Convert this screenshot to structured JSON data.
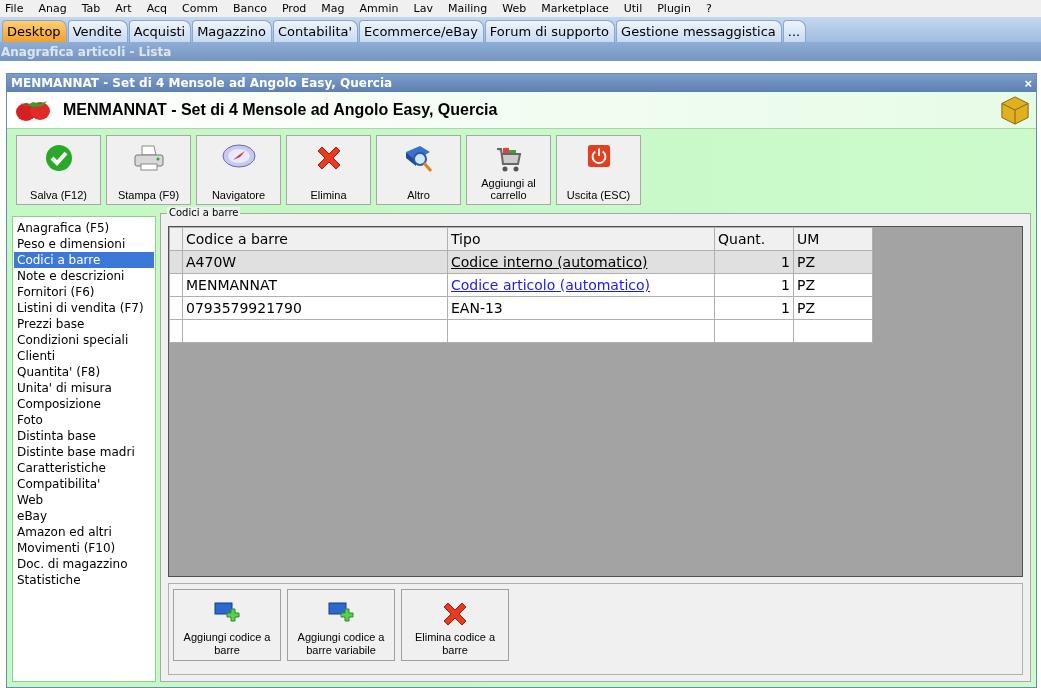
{
  "menu": [
    "File",
    "Anag",
    "Tab",
    "Art",
    "Acq",
    "Comm",
    "Banco",
    "Prod",
    "Mag",
    "Ammin",
    "Lav",
    "Mailing",
    "Web",
    "Marketplace",
    "Util",
    "Plugin",
    "?"
  ],
  "tabs": [
    {
      "label": "Desktop",
      "selected": true
    },
    {
      "label": "Vendite",
      "selected": false
    },
    {
      "label": "Acquisti",
      "selected": false
    },
    {
      "label": "Magazzino",
      "selected": false
    },
    {
      "label": "Contabilita'",
      "selected": false
    },
    {
      "label": "Ecommerce/eBay",
      "selected": false
    },
    {
      "label": "Forum di supporto",
      "selected": false
    },
    {
      "label": "Gestione messaggistica",
      "selected": false
    },
    {
      "label": "...",
      "selected": false
    }
  ],
  "breadcrumb": "Anagrafica articoli  - Lista",
  "window": {
    "title": "MENMANNAT - Set di 4 Mensole ad Angolo Easy, Quercia",
    "close": "×",
    "heading": "MENMANNAT - Set di 4 Mensole ad Angolo Easy, Quercia"
  },
  "toolbar": [
    {
      "label": "Salva (F12)",
      "kind": "check"
    },
    {
      "label": "Stampa (F9)",
      "kind": "printer"
    },
    {
      "label": "Navigatore",
      "kind": "compass"
    },
    {
      "label": "Elimina",
      "kind": "cross"
    },
    {
      "label": "Altro",
      "kind": "search"
    },
    {
      "label": "Aggiungi al carrello",
      "kind": "cart"
    },
    {
      "label": "Uscita (ESC)",
      "kind": "power"
    }
  ],
  "sidebar": {
    "items": [
      {
        "label": "Anagrafica (F5)",
        "selected": false
      },
      {
        "label": "Peso e dimensioni",
        "selected": false
      },
      {
        "label": "Codici a barre",
        "selected": true
      },
      {
        "label": "Note e descrizioni",
        "selected": false
      },
      {
        "label": "Fornitori (F6)",
        "selected": false
      },
      {
        "label": "Listini di vendita (F7)",
        "selected": false
      },
      {
        "label": "Prezzi base",
        "selected": false
      },
      {
        "label": "Condizioni speciali",
        "selected": false
      },
      {
        "label": "Clienti",
        "selected": false
      },
      {
        "label": "Quantita' (F8)",
        "selected": false
      },
      {
        "label": "Unita' di misura",
        "selected": false
      },
      {
        "label": "Composizione",
        "selected": false
      },
      {
        "label": "Foto",
        "selected": false
      },
      {
        "label": "Distinta base",
        "selected": false
      },
      {
        "label": "Distinte base madri",
        "selected": false
      },
      {
        "label": "Caratteristiche",
        "selected": false
      },
      {
        "label": "Compatibilita'",
        "selected": false
      },
      {
        "label": "Web",
        "selected": false
      },
      {
        "label": "eBay",
        "selected": false
      },
      {
        "label": "Amazon ed altri",
        "selected": false
      },
      {
        "label": "Movimenti (F10)",
        "selected": false
      },
      {
        "label": "Doc. di magazzino",
        "selected": false
      },
      {
        "label": "Statistiche",
        "selected": false
      }
    ]
  },
  "group": {
    "title": "Codici a barre",
    "table": {
      "columns": [
        "Codice a barre",
        "Tipo",
        "Quant.",
        "UM"
      ],
      "rows": [
        {
          "code": "A470W",
          "type": "Codice interno (automatico)",
          "link": true,
          "quantity": "1",
          "unit": "PZ",
          "selected": true
        },
        {
          "code": "MENMANNAT",
          "type": "Codice articolo (automatico)",
          "link": true,
          "quantity": "1",
          "unit": "PZ",
          "selected": false
        },
        {
          "code": "0793579921790",
          "type": "EAN-13",
          "link": false,
          "quantity": "1",
          "unit": "PZ",
          "selected": false
        }
      ]
    },
    "buttons": [
      {
        "label": "Aggiungi codice a barre",
        "kind": "add"
      },
      {
        "label": "Aggiungi codice a barre variabile",
        "kind": "add"
      },
      {
        "label": "Elimina codice a barre",
        "kind": "cross"
      }
    ]
  }
}
